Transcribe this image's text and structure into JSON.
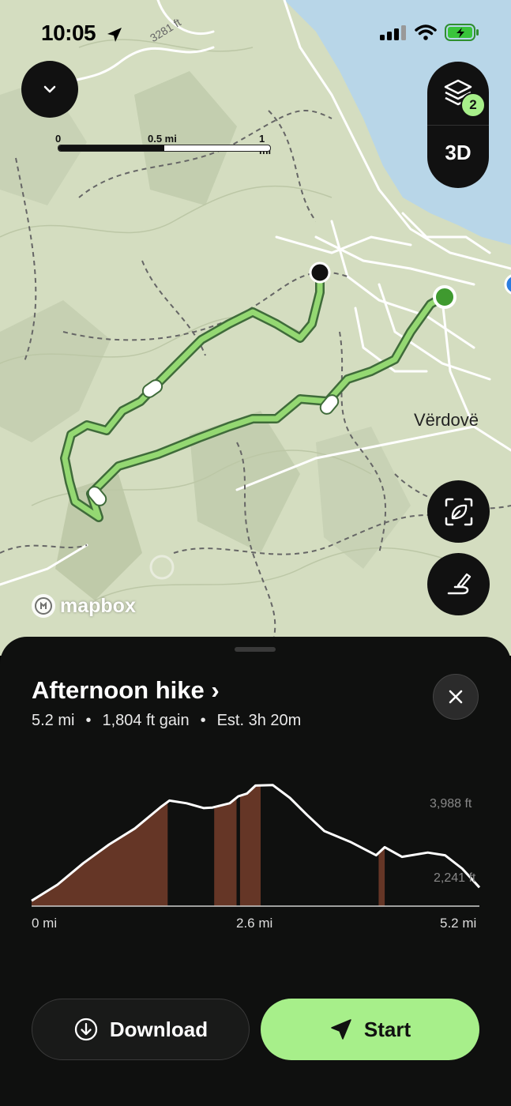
{
  "status_bar": {
    "time": "10:05"
  },
  "map": {
    "scale": {
      "label_0": "0",
      "label_mid": "0.5 mi",
      "label_max": "1 mi"
    },
    "layers_badge": "2",
    "btn_3d": "3D",
    "place_label": "Vërdovë",
    "contour_label": "3281 ft",
    "attribution": "mapbox"
  },
  "route": {
    "title": "Afternoon hike ›",
    "distance": "5.2 mi",
    "gain": "1,804 ft gain",
    "estimate": "Est. 3h 20m",
    "separator": "•"
  },
  "chart_data": {
    "type": "area",
    "x_unit": "mi",
    "y_unit": "ft",
    "x_ticks": [
      "0 mi",
      "2.6 mi",
      "5.2 mi"
    ],
    "y_ticks": [
      "3,988 ft",
      "2,241 ft"
    ],
    "x": [
      0,
      0.3,
      0.6,
      0.9,
      1.2,
      1.5,
      1.6,
      1.8,
      2.0,
      2.1,
      2.3,
      2.4,
      2.5,
      2.6,
      2.8,
      3.0,
      3.2,
      3.4,
      3.7,
      4.0,
      4.1,
      4.3,
      4.6,
      4.8,
      5.0,
      5.2
    ],
    "elevation_ft": [
      1600,
      1900,
      2300,
      2650,
      2950,
      3350,
      3470,
      3420,
      3330,
      3340,
      3420,
      3550,
      3600,
      3750,
      3760,
      3520,
      3200,
      2900,
      2700,
      2450,
      2600,
      2420,
      2500,
      2450,
      2200,
      1850
    ],
    "steep_segments_mi": [
      [
        0,
        1.58
      ],
      [
        2.12,
        2.38
      ],
      [
        2.42,
        2.66
      ],
      [
        4.03,
        4.1
      ]
    ],
    "colors": {
      "line": "#ffffff",
      "steep_fill": "#653626"
    }
  },
  "buttons": {
    "download": "Download",
    "start": "Start"
  },
  "colors": {
    "accent": "#a7ef8a",
    "sheet_bg": "#0f100f",
    "route_green": "#8fd36e"
  }
}
